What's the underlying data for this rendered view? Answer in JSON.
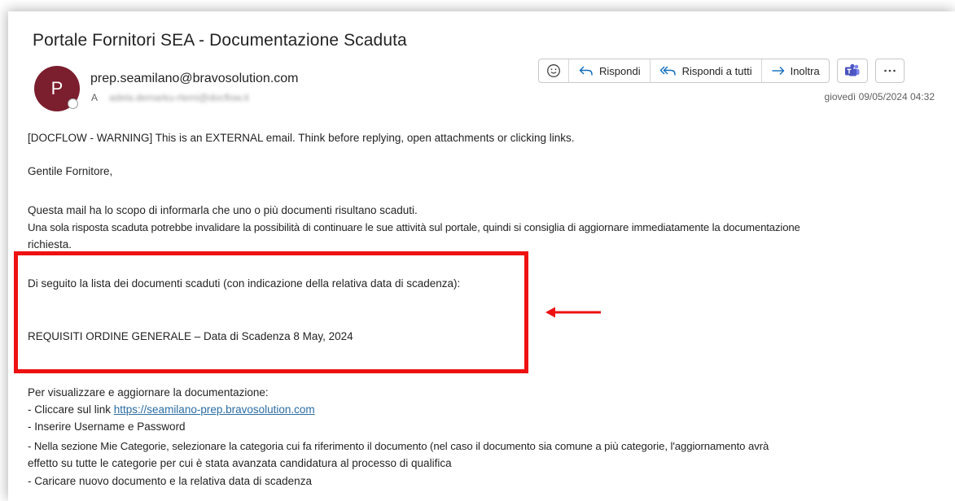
{
  "email": {
    "subject": "Portale Fornitori SEA - Documentazione Scaduta",
    "avatar_initial": "P",
    "sender": "prep.seamilano@bravosolution.com",
    "to_label": "A",
    "to_value": "adela.demarku-rtemi@docflow.it",
    "date": "giovedì 09/05/2024 04:32"
  },
  "toolbar": {
    "emoji_icon": "smiley-icon",
    "reply_label": "Rispondi",
    "reply_all_label": "Rispondi a tutti",
    "forward_label": "Inoltra",
    "teams_icon": "teams-icon",
    "more_icon": "more-icon"
  },
  "body": {
    "warning": "[DOCFLOW - WARNING] This is an EXTERNAL email. Think before replying, open attachments or clicking links.",
    "greeting": "Gentile Fornitore,",
    "para1_line1": "Questa mail ha lo scopo di informarla che uno o più documenti risultano scaduti.",
    "para1_line2": "Una sola risposta scaduta potrebbe invalidare la possibilità di continuare le sue attività sul portale, quindi si consiglia di aggiornare immediatamente la documentazione",
    "para1_line3": "richiesta.",
    "list_intro": "Di seguito la lista dei documenti scaduti (con indicazione della relativa data di scadenza):",
    "list_item": "REQUISITI ORDINE GENERALE – Data di Scadenza 8 May, 2024",
    "instructions_intro": "Per visualizzare e aggiornare la documentazione:",
    "step1_prefix": "- Cliccare sul link ",
    "step1_link": "https://seamilano-prep.bravosolution.com",
    "step2": "- Inserire Username e Password",
    "step3_line1": "- Nella sezione Mie Categorie, selezionare la categoria cui fa riferimento il documento (nel caso il documento sia comune a più categorie, l'aggiornamento avrà",
    "step3_line2": "effetto su tutte le categorie per cui è stata avanzata candidatura al processo di qualifica",
    "step4": "- Caricare nuovo documento e la relativa data di scadenza"
  },
  "colors": {
    "avatar_bg": "#7b1e2e",
    "highlight": "#ee1111",
    "link": "#2b6ca3",
    "accent_blue": "#0f6cbd",
    "teams": "#4b53bc"
  }
}
